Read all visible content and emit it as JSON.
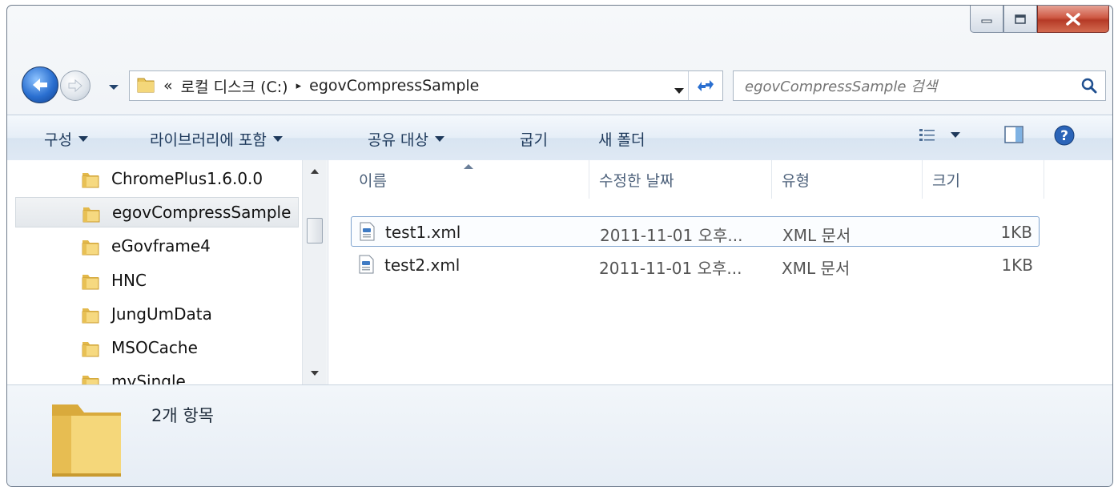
{
  "window": {
    "caption_buttons": [
      "minimize-icon",
      "maximize-icon",
      "close-icon"
    ]
  },
  "nav": {
    "breadcrumb": {
      "overflow": "«",
      "drive": "로컬 디스크 (C:)",
      "separator": "▸",
      "folder": "egovCompressSample"
    },
    "search_placeholder": "egovCompressSample 검색"
  },
  "toolbar": {
    "organize": "구성",
    "include_library": "라이브러리에 포함",
    "share_with": "공유 대상",
    "burn": "굽기",
    "new_folder": "새 폴더"
  },
  "navpane": {
    "items": [
      {
        "label": "ChromePlus1.6.0.0"
      },
      {
        "label": "egovCompressSample",
        "selected": true
      },
      {
        "label": "eGovframe4"
      },
      {
        "label": "HNC"
      },
      {
        "label": "JungUmData"
      },
      {
        "label": "MSOCache"
      },
      {
        "label": "mySingle"
      }
    ]
  },
  "filelist": {
    "columns": [
      "이름",
      "수정한 날짜",
      "유형",
      "크기"
    ],
    "rows": [
      {
        "name": "test1.xml",
        "modified": "2011-11-01 오후...",
        "type": "XML 문서",
        "size": "1KB",
        "selected": true
      },
      {
        "name": "test2.xml",
        "modified": "2011-11-01 오후...",
        "type": "XML 문서",
        "size": "1KB",
        "selected": false
      }
    ]
  },
  "details": {
    "item_count": "2개 항목"
  },
  "colors": {
    "accent": "#2a6fd0",
    "close": "#c8452f",
    "selection_border": "#7da2ce"
  }
}
